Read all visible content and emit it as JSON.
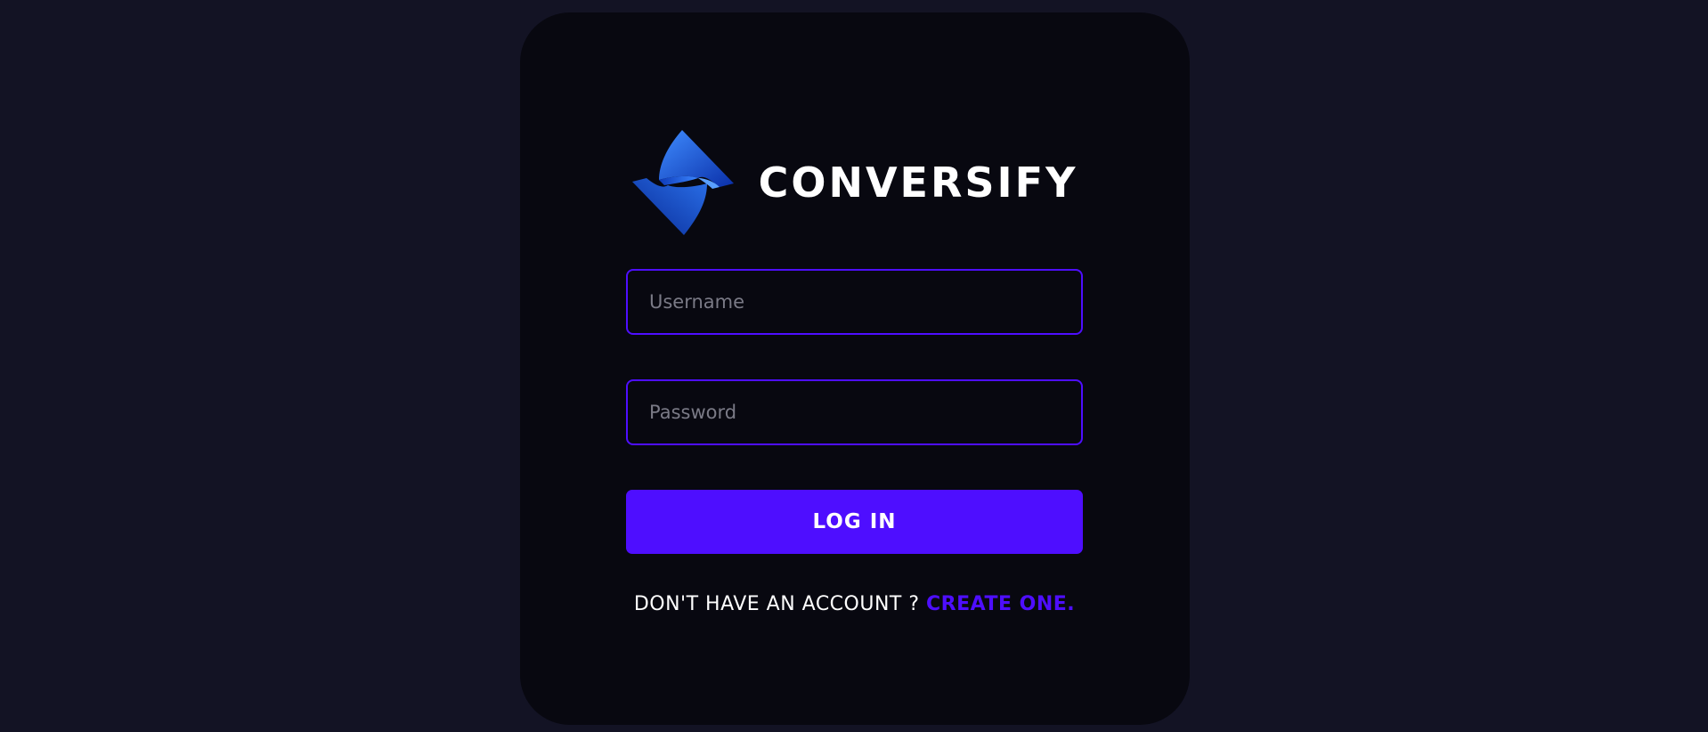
{
  "brand": {
    "name": "CONVERSIFY",
    "logo_icon": "conversify-s-logo-icon"
  },
  "form": {
    "username_placeholder": "Username",
    "password_placeholder": "Password",
    "login_label": "LOG IN"
  },
  "signup": {
    "prompt": "DON'T HAVE AN ACCOUNT ? ",
    "link_label": "CREATE ONE."
  },
  "colors": {
    "page_background": "#131324",
    "card_background": "#080810",
    "accent": "#4e0eff",
    "logo_blue": "#1a5fe0",
    "text": "#ffffff",
    "placeholder": "#7a7a86"
  }
}
